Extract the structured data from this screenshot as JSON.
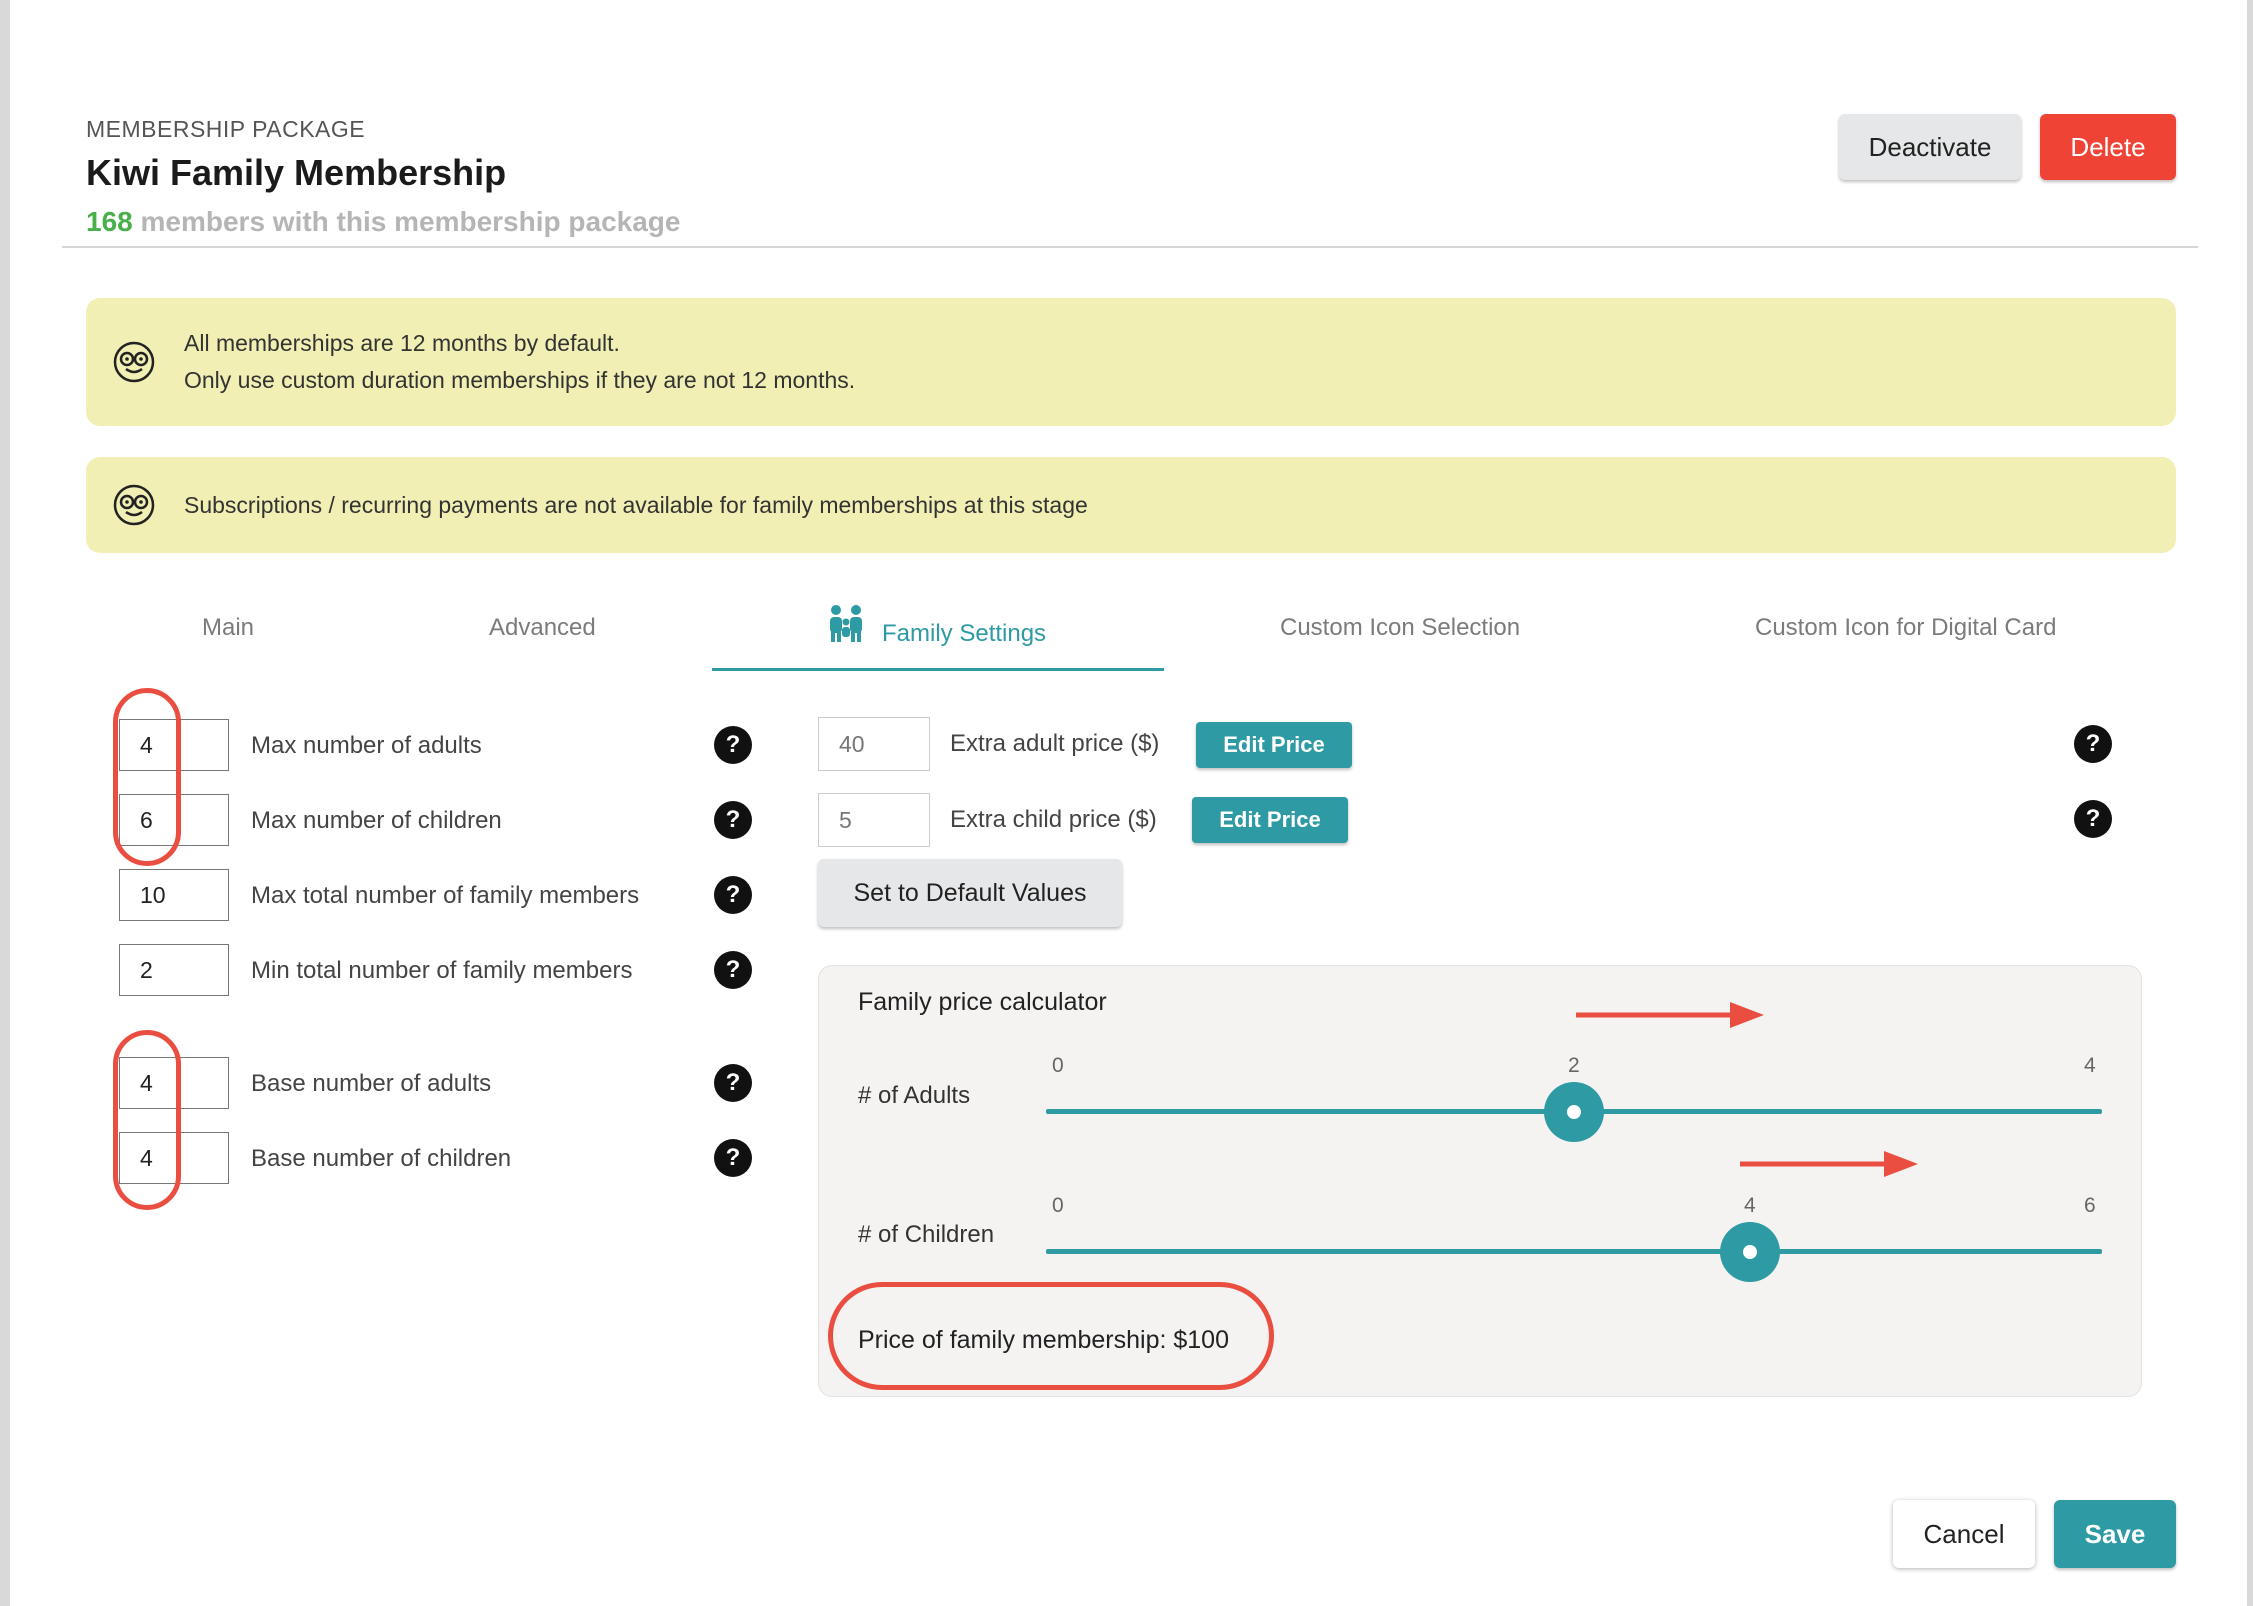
{
  "header": {
    "label": "MEMBERSHIP PACKAGE",
    "title": "Kiwi Family Membership",
    "member_count": "168",
    "member_count_suffix": "members with this membership package",
    "deactivate_label": "Deactivate",
    "delete_label": "Delete"
  },
  "notices": [
    {
      "icon": "nerd-face-icon",
      "lines": [
        "All memberships are 12 months by default.",
        "Only use custom duration memberships if they are not 12 months."
      ]
    },
    {
      "icon": "nerd-face-icon",
      "lines": [
        "Subscriptions / recurring payments are not available for family memberships at this stage"
      ]
    }
  ],
  "tabs": [
    {
      "label": "Main",
      "active": false
    },
    {
      "label": "Advanced",
      "active": false
    },
    {
      "label": "Family Settings",
      "active": true,
      "icon": "family-icon"
    },
    {
      "label": "Custom Icon Selection",
      "active": false
    },
    {
      "label": "Custom Icon for Digital Card",
      "active": false
    }
  ],
  "family_settings": {
    "fields": [
      {
        "value": "4",
        "label": "Max number of adults"
      },
      {
        "value": "6",
        "label": "Max number of children"
      },
      {
        "value": "10",
        "label": "Max total number of family members"
      },
      {
        "value": "2",
        "label": "Min total number of family members"
      },
      {
        "value": "4",
        "label": "Base number of adults"
      },
      {
        "value": "4",
        "label": "Base number of children"
      }
    ],
    "prices": [
      {
        "value": "40",
        "label": "Extra adult price ($)",
        "button": "Edit Price"
      },
      {
        "value": "5",
        "label": "Extra child price ($)",
        "button": "Edit Price"
      }
    ],
    "default_button": "Set to Default Values",
    "help_symbol": "?"
  },
  "calculator": {
    "title": "Family price calculator",
    "adults": {
      "label": "# of Adults",
      "min": "0",
      "max": "4",
      "value": "2",
      "min_num": 0,
      "max_num": 4,
      "value_num": 2
    },
    "children": {
      "label": "# of Children",
      "min": "0",
      "max": "6",
      "value": "4",
      "min_num": 0,
      "max_num": 6,
      "value_num": 4
    },
    "price_text": "Price of family membership: $100"
  },
  "footer": {
    "cancel_label": "Cancel",
    "save_label": "Save"
  },
  "colors": {
    "accent": "#2e9aa3",
    "danger": "#ef4335",
    "count": "#47b04b",
    "notice_bg": "#f1efb3",
    "annotation": "#ea4e41"
  }
}
